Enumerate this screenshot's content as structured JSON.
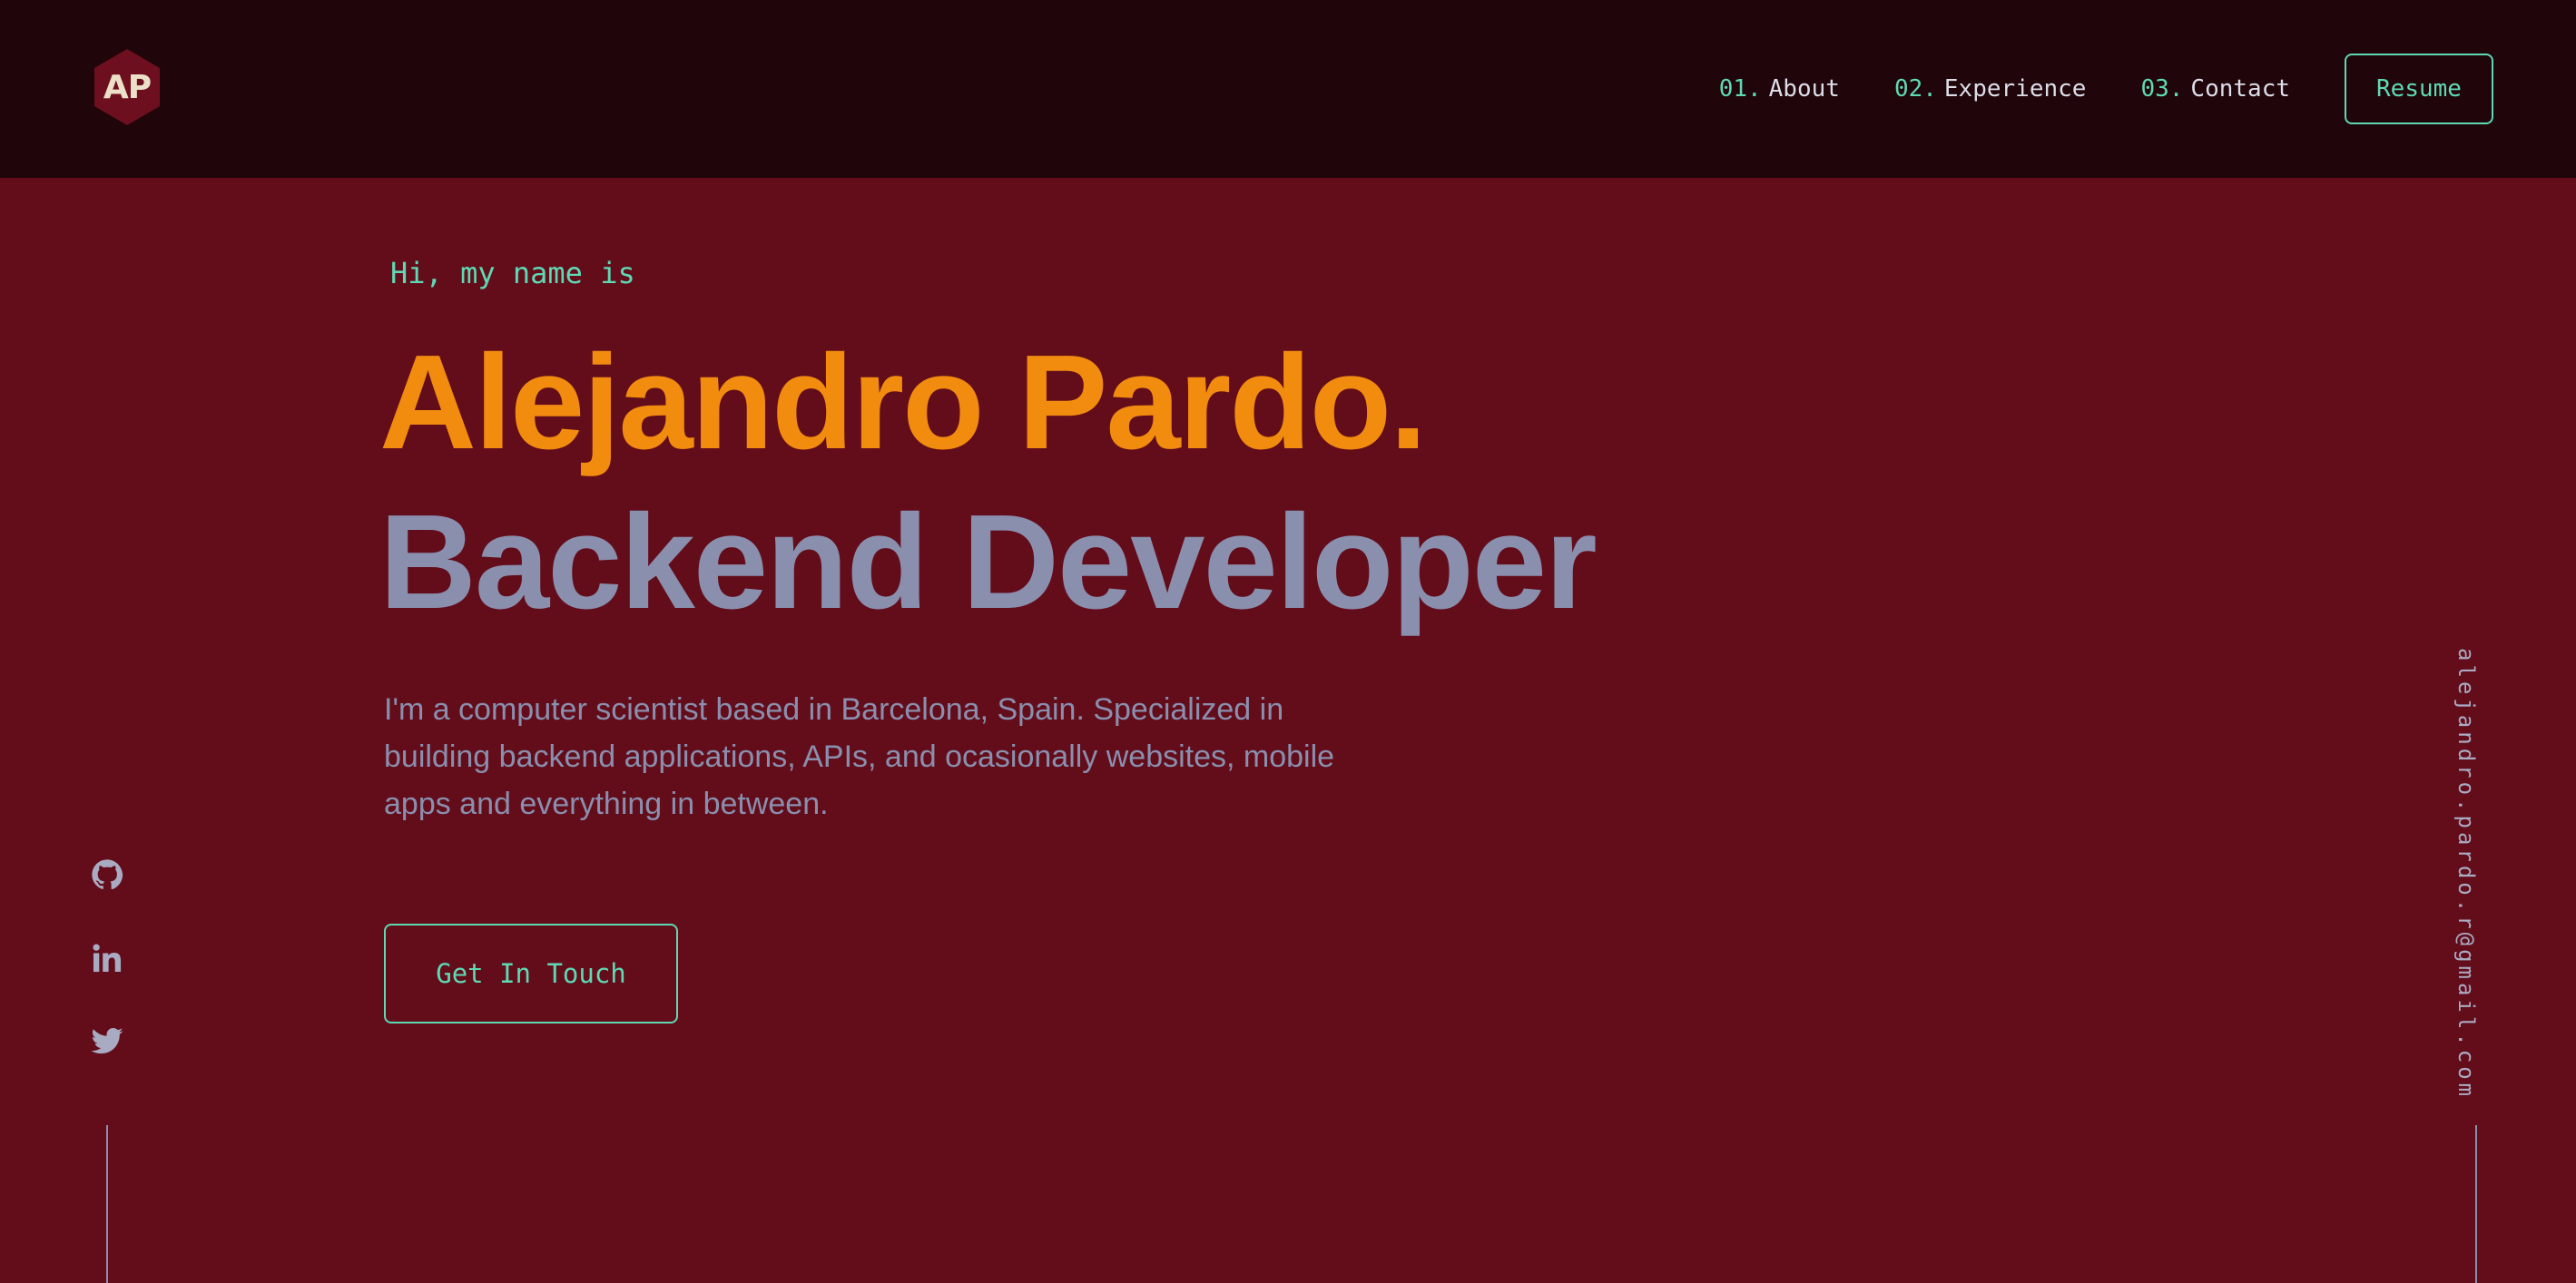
{
  "header": {
    "logo_text": "AP",
    "nav": [
      {
        "number": "01.",
        "label": "About"
      },
      {
        "number": "02.",
        "label": "Experience"
      },
      {
        "number": "03.",
        "label": "Contact"
      }
    ],
    "resume_label": "Resume"
  },
  "hero": {
    "greeting": "Hi, my name is",
    "name": "Alejandro Pardo.",
    "role": "Backend Developer",
    "bio": "I'm a computer scientist based in Barcelona, Spain. Specialized in building backend applications, APIs, and ocasionally websites, mobile apps and everything in between.",
    "cta_label": "Get In Touch"
  },
  "socials": [
    {
      "icon": "github-icon"
    },
    {
      "icon": "linkedin-icon"
    },
    {
      "icon": "twitter-icon"
    }
  ],
  "email": "alejandro.pardo.r@gmail.com",
  "colors": {
    "background": "#630d1b",
    "header_background": "#20050a",
    "accent": "#5ed9b4",
    "name": "#f28c0f",
    "muted": "#8a8fae"
  }
}
